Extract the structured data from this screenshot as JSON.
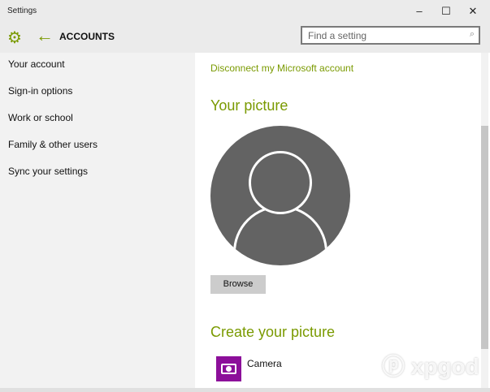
{
  "window": {
    "title": "Settings",
    "minimize": "–",
    "maximize": "☐",
    "close": "✕"
  },
  "header": {
    "title": "ACCOUNTS",
    "search_placeholder": "Find a setting"
  },
  "sidebar": {
    "items": [
      {
        "label": "Your account"
      },
      {
        "label": "Sign-in options"
      },
      {
        "label": "Work or school"
      },
      {
        "label": "Family & other users"
      },
      {
        "label": "Sync your settings"
      }
    ]
  },
  "main": {
    "disconnect_link": "Disconnect my Microsoft account",
    "your_picture": "Your picture",
    "browse": "Browse",
    "create_picture": "Create your picture",
    "camera": "Camera"
  },
  "watermark": "xpgod",
  "colors": {
    "accent": "#7a9a01",
    "camera_tile": "#8c0f9a"
  }
}
